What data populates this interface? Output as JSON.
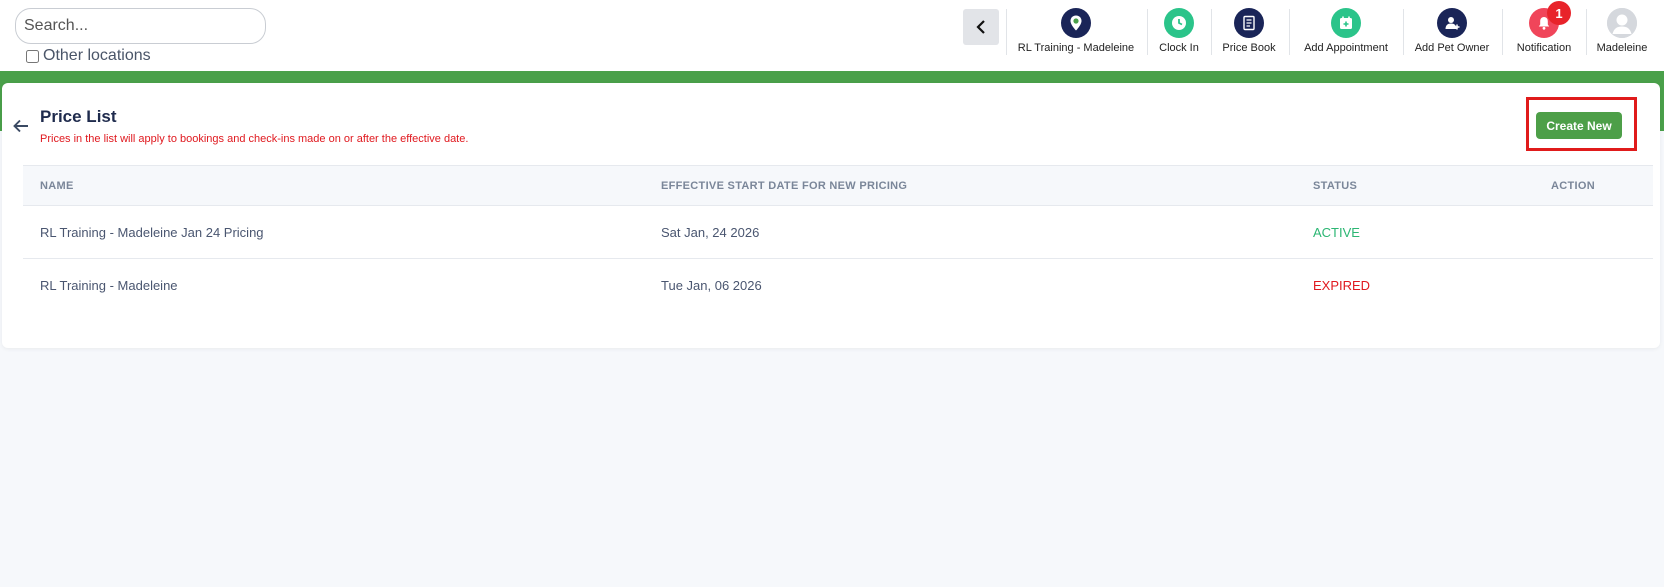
{
  "search": {
    "placeholder": "Search..."
  },
  "other_locations": {
    "label": "Other locations"
  },
  "nav": {
    "location_label": "RL Training - Madeleine",
    "clock_in_label": "Clock In",
    "price_book_label": "Price Book",
    "add_appointment_label": "Add Appointment",
    "add_pet_owner_label": "Add Pet Owner",
    "notification_label": "Notification",
    "notification_count": "1",
    "user_label": "Madeleine"
  },
  "page": {
    "title": "Price List",
    "subtitle": "Prices in the list will apply to bookings and check-ins made on or after the effective date.",
    "create_label": "Create New"
  },
  "table": {
    "columns": [
      "NAME",
      "EFFECTIVE START DATE FOR NEW PRICING",
      "STATUS",
      "ACTION"
    ],
    "rows": [
      {
        "name": "RL Training - Madeleine Jan 24 Pricing",
        "date": "Sat Jan, 24 2026",
        "status": "ACTIVE"
      },
      {
        "name": "RL Training - Madeleine",
        "date": "Tue Jan, 06 2026",
        "status": "EXPIRED"
      }
    ]
  },
  "colors": {
    "accent_green": "#4aa04a",
    "navy": "#1a2558",
    "active": "#2bb673",
    "expired": "#e0191f",
    "notification": "#f0455a",
    "highlight": "#e01b1b"
  },
  "icons": {
    "back": "arrow-left-icon",
    "collapse": "chevron-left-icon",
    "location": "location-pin-icon",
    "clock": "clock-icon",
    "price_book": "document-icon",
    "appointment": "calendar-plus-icon",
    "pet_owner": "user-plus-icon",
    "notification": "bell-icon",
    "avatar": "avatar-icon"
  }
}
